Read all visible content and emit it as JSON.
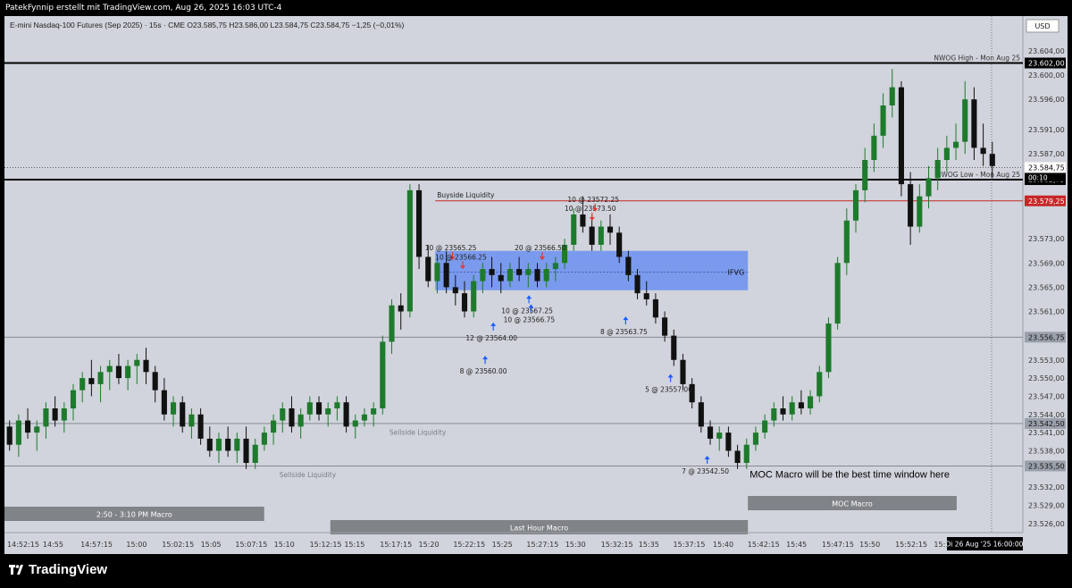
{
  "header": {
    "creator": "PatekFynnip erstellt mit TradingView.com, Aug 26, 2025 16:03 UTC-4",
    "symbol_line": "E-mini Nasdaq-100 Futures (Sep 2025) · 15s · CME  O23.585,75  H23.586,00  L23.584,75  C23.584,75  −1,25 (−0,01%)"
  },
  "currency": "USD",
  "branding": {
    "logo_text": "TradingView"
  },
  "colors": {
    "bull": "#1e7a2c",
    "bear": "#111111",
    "fvg": "#6b8ff0",
    "red_level": "#c62828",
    "buy_arrow": "#1a5cff",
    "sell_arrow": "#e53935"
  },
  "chart_data": {
    "type": "candlestick",
    "symbol": "E-mini Nasdaq-100 Futures (Sep 2025)",
    "timeframe": "15s",
    "ylim": [
      23524.5,
      23606.5
    ],
    "price_ticks": [
      "23.604,00",
      "23.600,00",
      "23.596,00",
      "23.591,00",
      "23.587,00",
      "23.573,00",
      "23.569,00",
      "23.565,00",
      "23.561,00",
      "23.553,00",
      "23.550,00",
      "23.547,00",
      "23.544,00",
      "23.541,00",
      "23.538,00",
      "23.532,00",
      "23.529,00",
      "23.526,00"
    ],
    "price_tick_values": [
      23604,
      23600,
      23596,
      23591,
      23587,
      23573,
      23569,
      23565,
      23561,
      23553,
      23550,
      23547,
      23544,
      23541,
      23538,
      23532,
      23529,
      23526
    ],
    "price_badges": [
      {
        "text": "23.602,00",
        "value": 23602,
        "style": "dark"
      },
      {
        "text": "23.584,75",
        "value": 23584.75,
        "style": "light"
      },
      {
        "text": "23.582,75",
        "value": 23582.75,
        "style": "dark"
      },
      {
        "text": "23.579,25",
        "value": 23579.25,
        "style": "red"
      },
      {
        "text": "23.556,75",
        "value": 23556.75,
        "style": "gray"
      },
      {
        "text": "23.542,50",
        "value": 23542.5,
        "style": "gray"
      },
      {
        "text": "23.535,50",
        "value": 23535.5,
        "style": "gray"
      }
    ],
    "last_price": {
      "text": "23.584,75",
      "countdown": "00:10",
      "value": 23584.75
    },
    "time_ticks": [
      "14:52:15",
      "14:55",
      "14:57:15",
      "15:00",
      "15:02:15",
      "15:05",
      "15:07:15",
      "15:10",
      "15:12:15",
      "15:15",
      "15:17:15",
      "15:20",
      "15:22:15",
      "15:25",
      "15:27:15",
      "15:30",
      "15:32:15",
      "15:35",
      "15:37:15",
      "15:40",
      "15:42:15",
      "15:45",
      "15:47:15",
      "15:50",
      "15:52:15",
      "15:55"
    ],
    "time_tick_x": [
      0,
      0.035,
      0.072,
      0.117,
      0.152,
      0.19,
      0.224,
      0.262,
      0.297,
      0.331,
      0.366,
      0.404,
      0.438,
      0.476,
      0.51,
      0.548,
      0.583,
      0.62,
      0.654,
      0.693,
      0.727,
      0.765,
      0.8,
      0.837,
      0.872,
      0.91
    ],
    "time_badge": "Di 26 Aug '25   16:00:00",
    "candles": [
      [
        23542,
        23543,
        23538,
        23539
      ],
      [
        23539,
        23544,
        23537,
        23543
      ],
      [
        23543,
        23545,
        23540,
        23541
      ],
      [
        23541,
        23543,
        23538,
        23542
      ],
      [
        23542,
        23546,
        23540,
        23545
      ],
      [
        23545,
        23547,
        23542,
        23543
      ],
      [
        23543,
        23546,
        23541,
        23545
      ],
      [
        23545,
        23549,
        23543,
        23548
      ],
      [
        23548,
        23551,
        23546,
        23550
      ],
      [
        23550,
        23553,
        23547,
        23549
      ],
      [
        23549,
        23552,
        23546,
        23551
      ],
      [
        23551,
        23553,
        23548,
        23552
      ],
      [
        23552,
        23554,
        23549,
        23550
      ],
      [
        23550,
        23553,
        23548,
        23552
      ],
      [
        23552,
        23554,
        23549,
        23553
      ],
      [
        23553,
        23555,
        23549,
        23551
      ],
      [
        23551,
        23552,
        23546,
        23548
      ],
      [
        23548,
        23550,
        23543,
        23544
      ],
      [
        23544,
        23547,
        23542,
        23546
      ],
      [
        23546,
        23547,
        23541,
        23542
      ],
      [
        23542,
        23545,
        23540,
        23544
      ],
      [
        23544,
        23545,
        23539,
        23540
      ],
      [
        23540,
        23542,
        23537,
        23538
      ],
      [
        23538,
        23541,
        23536,
        23540
      ],
      [
        23540,
        23542,
        23537,
        23538
      ],
      [
        23538,
        23541,
        23536,
        23540
      ],
      [
        23540,
        23542,
        23535,
        23536
      ],
      [
        23536,
        23540,
        23535,
        23539
      ],
      [
        23539,
        23542,
        23538,
        23541
      ],
      [
        23541,
        23544,
        23539,
        23543
      ],
      [
        23543,
        23546,
        23541,
        23545
      ],
      [
        23545,
        23547,
        23541,
        23542
      ],
      [
        23542,
        23545,
        23540,
        23544
      ],
      [
        23544,
        23547,
        23543,
        23546
      ],
      [
        23546,
        23547,
        23543,
        23544
      ],
      [
        23544,
        23546,
        23542,
        23545
      ],
      [
        23545,
        23547,
        23543,
        23546
      ],
      [
        23546,
        23547,
        23541,
        23542
      ],
      [
        23542,
        23544,
        23540,
        23543
      ],
      [
        23543,
        23545,
        23542,
        23544
      ],
      [
        23544,
        23546,
        23542,
        23545
      ],
      [
        23545,
        23557,
        23544,
        23556
      ],
      [
        23556,
        23563,
        23554,
        23562
      ],
      [
        23562,
        23564,
        23558,
        23561
      ],
      [
        23561,
        23582,
        23560,
        23581
      ],
      [
        23581,
        23582,
        23568,
        23570
      ],
      [
        23570,
        23572,
        23565,
        23566
      ],
      [
        23566,
        23570,
        23564,
        23569
      ],
      [
        23569,
        23571,
        23564,
        23565
      ],
      [
        23565,
        23567,
        23562,
        23564
      ],
      [
        23564,
        23566,
        23560,
        23561
      ],
      [
        23561,
        23567,
        23560,
        23566
      ],
      [
        23566,
        23569,
        23564,
        23568
      ],
      [
        23568,
        23570,
        23565,
        23567
      ],
      [
        23567,
        23569,
        23564,
        23566
      ],
      [
        23566,
        23569,
        23565,
        23568
      ],
      [
        23568,
        23570,
        23566,
        23567
      ],
      [
        23567,
        23569,
        23565,
        23568
      ],
      [
        23568,
        23569,
        23565,
        23566
      ],
      [
        23566,
        23569,
        23565,
        23568
      ],
      [
        23568,
        23570,
        23566,
        23569
      ],
      [
        23569,
        23573,
        23568,
        23572
      ],
      [
        23572,
        23578,
        23571,
        23577
      ],
      [
        23577,
        23580,
        23574,
        23575
      ],
      [
        23575,
        23577,
        23571,
        23572
      ],
      [
        23572,
        23576,
        23571,
        23575
      ],
      [
        23575,
        23577,
        23572,
        23574
      ],
      [
        23574,
        23575,
        23569,
        23570
      ],
      [
        23570,
        23571,
        23566,
        23567
      ],
      [
        23567,
        23568,
        23563,
        23564
      ],
      [
        23564,
        23566,
        23562,
        23563
      ],
      [
        23563,
        23564,
        23559,
        23560
      ],
      [
        23560,
        23561,
        23556,
        23557
      ],
      [
        23557,
        23558,
        23552,
        23553
      ],
      [
        23553,
        23554,
        23548,
        23549
      ],
      [
        23549,
        23550,
        23545,
        23546
      ],
      [
        23546,
        23547,
        23541,
        23542
      ],
      [
        23542,
        23543,
        23539,
        23540
      ],
      [
        23540,
        23542,
        23538,
        23541
      ],
      [
        23541,
        23542,
        23537,
        23538
      ],
      [
        23538,
        23539,
        23535,
        23536
      ],
      [
        23536,
        23540,
        23535,
        23539
      ],
      [
        23539,
        23542,
        23538,
        23541
      ],
      [
        23541,
        23544,
        23540,
        23543
      ],
      [
        23543,
        23546,
        23542,
        23545
      ],
      [
        23545,
        23547,
        23543,
        23544
      ],
      [
        23544,
        23547,
        23543,
        23546
      ],
      [
        23546,
        23548,
        23544,
        23545
      ],
      [
        23545,
        23548,
        23544,
        23547
      ],
      [
        23547,
        23552,
        23546,
        23551
      ],
      [
        23551,
        23560,
        23550,
        23559
      ],
      [
        23559,
        23570,
        23558,
        23569
      ],
      [
        23569,
        23578,
        23567,
        23576
      ],
      [
        23576,
        23582,
        23574,
        23581
      ],
      [
        23581,
        23588,
        23579,
        23586
      ],
      [
        23586,
        23592,
        23584,
        23590
      ],
      [
        23590,
        23597,
        23588,
        23595
      ],
      [
        23595,
        23601,
        23593,
        23598
      ],
      [
        23598,
        23599,
        23580,
        23582
      ],
      [
        23582,
        23584,
        23572,
        23575
      ],
      [
        23575,
        23582,
        23574,
        23580
      ],
      [
        23580,
        23585,
        23578,
        23583
      ],
      [
        23583,
        23588,
        23581,
        23586
      ],
      [
        23586,
        23590,
        23584,
        23588
      ],
      [
        23588,
        23592,
        23586,
        23589
      ],
      [
        23589,
        23599,
        23587,
        23596
      ],
      [
        23596,
        23598,
        23586,
        23588
      ],
      [
        23588,
        23592,
        23585,
        23587
      ],
      [
        23587,
        23589,
        23583,
        23585
      ]
    ],
    "levels": [
      {
        "label": "NWOG High - Mon Aug 25",
        "value": 23602,
        "style": "thick"
      },
      {
        "label": "NWOG Low - Mon Aug 25",
        "value": 23582.75,
        "style": "thick"
      },
      {
        "value": 23584.75,
        "style": "dotted"
      },
      {
        "value": 23579.25,
        "style": "red"
      },
      {
        "value": 23556.75,
        "style": "gray"
      },
      {
        "value": 23542.5,
        "style": "gray"
      },
      {
        "value": 23535.5,
        "style": "gray"
      }
    ],
    "fvg": {
      "label": "IFVG",
      "top": 23571,
      "bottom": 23564.5,
      "mid": 23567.5,
      "x_start": 0.423,
      "x_end": 0.73
    },
    "buyside_liquidity": {
      "label": "Buyside Liquidity",
      "value": 23579.25,
      "x_start": 0.423
    },
    "sellside_liquidity": [
      {
        "label": "Sellside Liquidity",
        "x": 0.378,
        "value": 23542
      },
      {
        "label": "Sellside Liquidity",
        "x": 0.27,
        "value": 23535
      }
    ],
    "fills": [
      {
        "text": "10 @ 23573.50",
        "x": 0.577,
        "value": 23577,
        "dir": "sell"
      },
      {
        "text": "10 @ 23572.25",
        "x": 0.58,
        "value": 23578.5,
        "dir": "sell"
      },
      {
        "text": "10 @ 23565.25",
        "x": 0.44,
        "value": 23570.5,
        "dir": "sell"
      },
      {
        "text": "10 @ 23566.25",
        "x": 0.45,
        "value": 23569,
        "dir": "sell"
      },
      {
        "text": "20 @ 23566.50",
        "x": 0.528,
        "value": 23570.5,
        "dir": "sell"
      },
      {
        "text": "10 @ 23567.25",
        "x": 0.515,
        "value": 23562.5,
        "dir": "buy"
      },
      {
        "text": "10 @ 23566.75",
        "x": 0.517,
        "value": 23561,
        "dir": "buy"
      },
      {
        "text": "12 @ 23564.00",
        "x": 0.48,
        "value": 23558,
        "dir": "buy"
      },
      {
        "text": "8 @ 23560.00",
        "x": 0.472,
        "value": 23552.5,
        "dir": "buy"
      },
      {
        "text": "8 @ 23563.75",
        "x": 0.61,
        "value": 23559,
        "dir": "buy"
      },
      {
        "text": "5 @ 23557.00",
        "x": 0.654,
        "value": 23549.5,
        "dir": "buy"
      },
      {
        "text": "7 @ 23542.50",
        "x": 0.69,
        "value": 23536,
        "dir": "buy"
      }
    ],
    "sessions": [
      {
        "label": "2:50 - 3:10 PM Macro",
        "x_start": 0.0,
        "x_end": 0.255,
        "row": 1
      },
      {
        "label": "Last Hour Macro",
        "x_start": 0.32,
        "x_end": 0.73,
        "row": 2
      },
      {
        "label": "MOC Macro",
        "x_start": 0.73,
        "x_end": 0.935,
        "row": 0
      }
    ],
    "annotation": "MOC Macro will be the best time window here"
  }
}
